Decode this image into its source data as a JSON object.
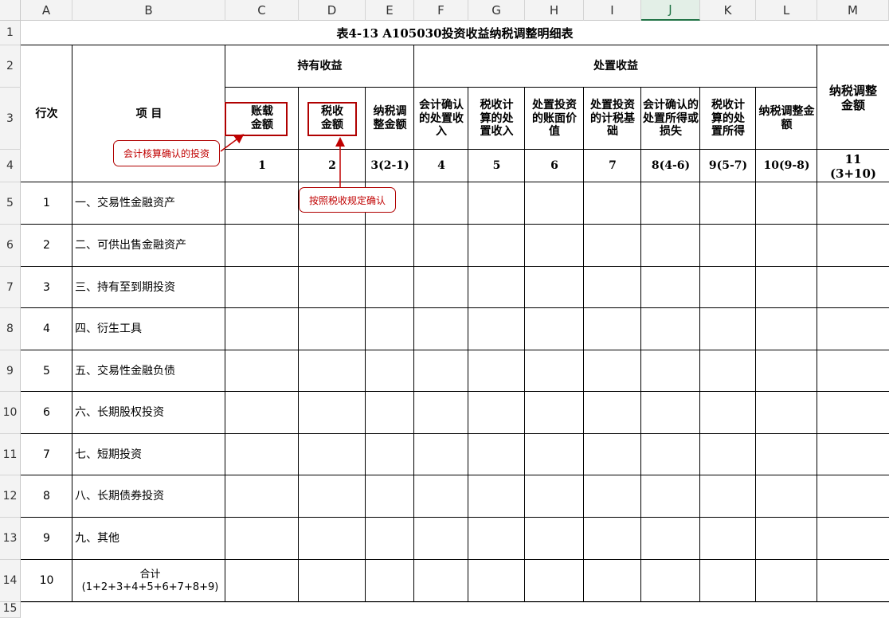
{
  "columns": [
    "A",
    "B",
    "C",
    "D",
    "E",
    "F",
    "G",
    "H",
    "I",
    "J",
    "K",
    "L",
    "M"
  ],
  "rows": [
    "1",
    "2",
    "3",
    "4",
    "5",
    "6",
    "7",
    "8",
    "9",
    "10",
    "11",
    "12",
    "13",
    "14",
    "15"
  ],
  "title": "表4-13 A105030投资收益纳税调整明细表",
  "headers": {
    "row_no": "行次",
    "item": "项 目",
    "holding_income": "持有收益",
    "disposal_income": "处置收益",
    "tax_adjust_amount": "纳税调整金额",
    "c3": "账载金额",
    "d3": "税收金额",
    "e3": "纳税调整金额",
    "f3": "会计确认的处置收入",
    "g3": "税收计算的处置收入",
    "h3": "处置投资的账面价值",
    "i3": "处置投资的计税基础",
    "j3": "会计确认的处置所得或损失",
    "k3": "税收计算的处置所得",
    "l3": "纳税调整金额"
  },
  "col_numbers": [
    "1",
    "2",
    "3(2-1)",
    "4",
    "5",
    "6",
    "7",
    "8(4-6)",
    "9(5-7)",
    "10(9-8)",
    "11",
    "(3+10)"
  ],
  "items": [
    {
      "no": "1",
      "name": "一、交易性金融资产"
    },
    {
      "no": "2",
      "name": "二、可供出售金融资产"
    },
    {
      "no": "3",
      "name": "三、持有至到期投资"
    },
    {
      "no": "4",
      "name": "四、衍生工具"
    },
    {
      "no": "5",
      "name": "五、交易性金融负债"
    },
    {
      "no": "6",
      "name": "六、长期股权投资"
    },
    {
      "no": "7",
      "name": "七、短期投资"
    },
    {
      "no": "8",
      "name": "八、长期债券投资"
    },
    {
      "no": "9",
      "name": "九、其他"
    },
    {
      "no": "10",
      "name": "合计(1+2+3+4+5+6+7+8+9)"
    }
  ],
  "annotations": {
    "accounting": "会计核算确认的投资",
    "tax": "按照税收规定确认"
  },
  "colors": {
    "annotation_red": "#c00000",
    "selected_header": "#217346"
  }
}
